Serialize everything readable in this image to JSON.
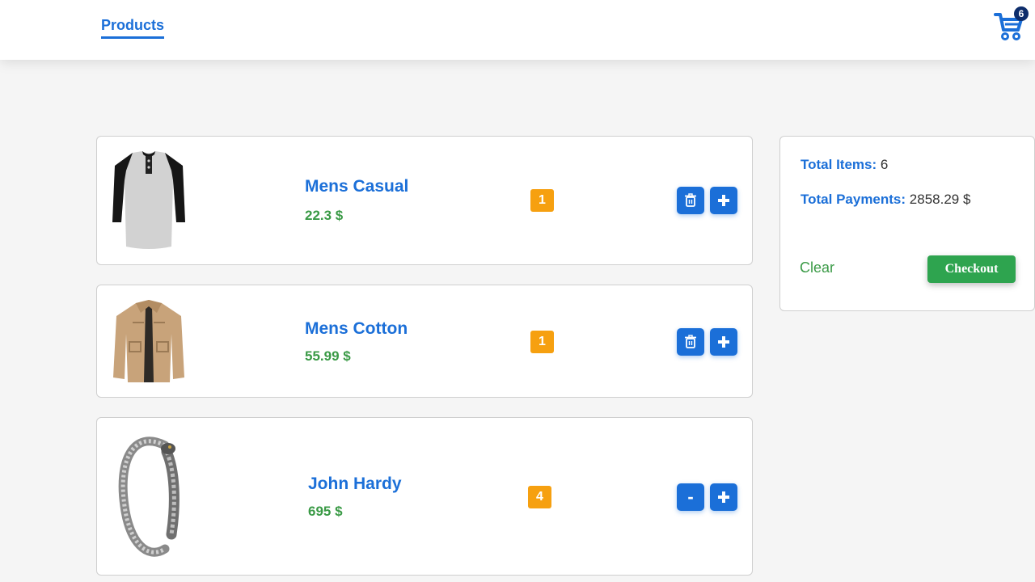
{
  "nav": {
    "products_label": "Products"
  },
  "cart": {
    "count": "6"
  },
  "items": [
    {
      "name": "Mens Casual",
      "price": "22.3 $",
      "quantity": "1",
      "decrement": "delete"
    },
    {
      "name": "Mens Cotton",
      "price": "55.99 $",
      "quantity": "1",
      "decrement": "delete"
    },
    {
      "name": "John Hardy",
      "price": "695 $",
      "quantity": "4",
      "decrement": "-"
    }
  ],
  "summary": {
    "total_items_label": "Total Items:",
    "total_items_value": "6",
    "total_payments_label": "Total Payments:",
    "total_payments_value": "2858.29 $",
    "clear_label": "Clear",
    "checkout_label": "Checkout"
  },
  "colors": {
    "primary": "#1b6fd8",
    "price": "#3a9a46",
    "quantity_badge": "#f6a010",
    "checkout": "#2ea44f",
    "cart_badge": "#0d2d6b"
  },
  "icons": [
    "cart-icon",
    "trash-icon",
    "plus-icon",
    "minus-icon"
  ]
}
